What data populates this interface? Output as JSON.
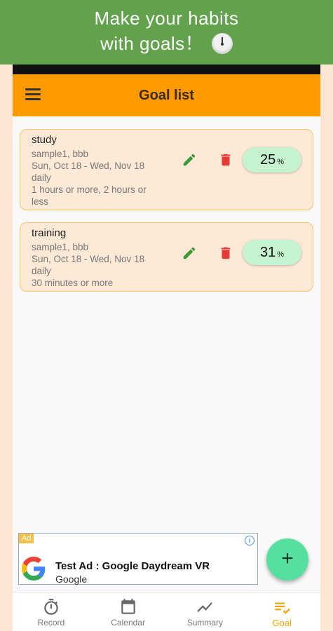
{
  "promo": {
    "line1": "Make your habits",
    "line2": "with goals！"
  },
  "appbar": {
    "title": "Goal list"
  },
  "goals": [
    {
      "name": "study",
      "tags": "sample1, bbb",
      "dates": "Sun, Oct 18 - Wed, Nov 18",
      "frequency": "daily",
      "target": "1 hours or more, 2 hours or less",
      "percent": "25",
      "unit": "%"
    },
    {
      "name": "training",
      "tags": "sample1, bbb",
      "dates": "Sun, Oct 18 - Wed, Nov 18",
      "frequency": "daily",
      "target": "30 minutes or more",
      "percent": "31",
      "unit": "%"
    }
  ],
  "ad": {
    "tag": "Ad",
    "info": "i",
    "title": "Test Ad : Google Daydream VR",
    "advertiser": "Google"
  },
  "fab": {
    "label": "+"
  },
  "bottom_nav": [
    {
      "label": "Record",
      "icon": "stopwatch-icon"
    },
    {
      "label": "Calendar",
      "icon": "calendar-icon"
    },
    {
      "label": "Summary",
      "icon": "trend-icon"
    },
    {
      "label": "Goal",
      "icon": "goal-list-icon",
      "active": true
    }
  ],
  "colors": {
    "promo_bg": "#62a24d",
    "appbar": "#ff9a00",
    "card_bg": "#fde9d6",
    "card_border": "#f5c76b",
    "percent_pill": "#c5f2cf",
    "edit": "#3a9a3a",
    "delete": "#e53935",
    "fab": "#56e0a0",
    "active_nav": "#f0a400"
  }
}
